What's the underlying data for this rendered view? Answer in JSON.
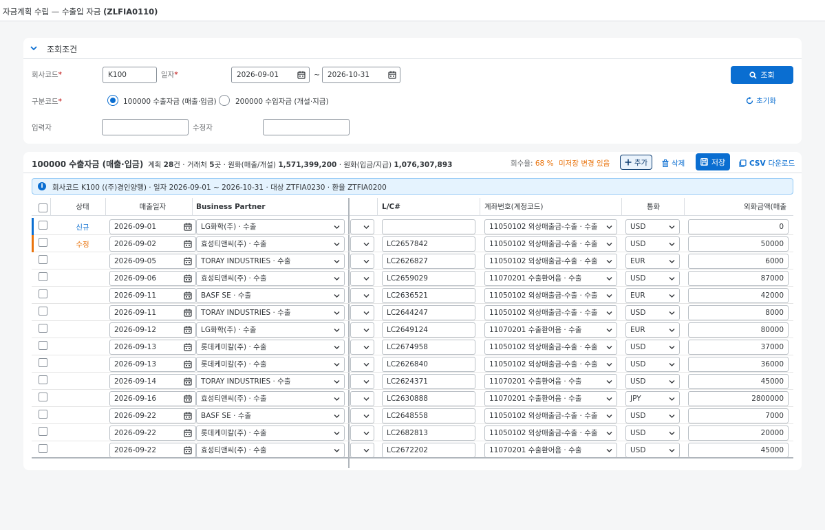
{
  "app": {
    "title_prefix": "자금계획 수립 — 수출입 자금 ",
    "title_code": "(ZLFIA0110)"
  },
  "filter": {
    "section_title": "조회조건",
    "company_label": "회사코드",
    "company_value": "K100",
    "date_label": "일자",
    "date_from": "2026-09-01",
    "date_sep": "~",
    "date_to": "2026-10-31",
    "type_label": "구분코드",
    "options": [
      {
        "label": "100000 수출자금 (매출·입금)",
        "selected": true
      },
      {
        "label": "200000 수입자금 (개설·지급)",
        "selected": false
      }
    ],
    "creator_label": "입력자",
    "creator_value": "",
    "modifier_label": "수정자",
    "modifier_value": "",
    "search_button": "조회",
    "reset_button": "초기화",
    "required_mark": "*"
  },
  "toolbar": {
    "title": "100000 수출자금 (매출·입금)",
    "plan_label": "계획",
    "plan_count": "28",
    "plan_unit": "건 · 거래처",
    "partner_count": "5",
    "partner_unit": "곳 · 원화(매출/개설)",
    "krw_sales": "1,571,399,200",
    "krw_recv_label": "· 원화(입금/지급)",
    "krw_recv": "1,076,307,893",
    "rate_label": "회수율:",
    "rate_value": "68 %",
    "unsaved": "미저장 변경 있음",
    "add_button": "추가",
    "delete_button": "삭제",
    "save_button": "저장",
    "csv_prefix": "CSV",
    "csv_suffix": "다운로드"
  },
  "info_text": "회사코드 K100 ((주)경인양행) · 일자 2026-09-01 ~ 2026-10-31 · 대상 ZTFIA0230 · 환율 ZTFIA0200",
  "columns": {
    "status": "상태",
    "sales_date": "매출일자",
    "partner": "Business Partner",
    "lc": "L/C#",
    "account": "계좌번호(계정코드)",
    "currency": "통화",
    "amount": "외화금액(매출"
  },
  "colors": {
    "accent": "#0a6ed1",
    "new_status": "#0a6ed1",
    "modified_status": "#e9730c"
  },
  "rows": [
    {
      "status": "신규",
      "date": "2026-09-01",
      "partner": "LG화학(주) · 수출",
      "lc": "",
      "account": "11050102 외상매출금-수출 · 수출",
      "currency": "USD",
      "amount": "0"
    },
    {
      "status": "수정",
      "date": "2026-09-02",
      "partner": "효성티앤씨(주) · 수출",
      "lc": "LC2657842",
      "account": "11050102 외상매출금-수출 · 수출",
      "currency": "USD",
      "amount": "50000"
    },
    {
      "status": "",
      "date": "2026-09-05",
      "partner": "TORAY INDUSTRIES · 수출",
      "lc": "LC2626827",
      "account": "11050102 외상매출금-수출 · 수출",
      "currency": "EUR",
      "amount": "6000"
    },
    {
      "status": "",
      "date": "2026-09-06",
      "partner": "효성티앤씨(주) · 수출",
      "lc": "LC2659029",
      "account": "11070201 수출환어음 · 수출",
      "currency": "USD",
      "amount": "87000"
    },
    {
      "status": "",
      "date": "2026-09-11",
      "partner": "BASF SE · 수출",
      "lc": "LC2636521",
      "account": "11050102 외상매출금-수출 · 수출",
      "currency": "EUR",
      "amount": "42000"
    },
    {
      "status": "",
      "date": "2026-09-11",
      "partner": "TORAY INDUSTRIES · 수출",
      "lc": "LC2644247",
      "account": "11050102 외상매출금-수출 · 수출",
      "currency": "USD",
      "amount": "8000"
    },
    {
      "status": "",
      "date": "2026-09-12",
      "partner": "LG화학(주) · 수출",
      "lc": "LC2649124",
      "account": "11070201 수출환어음 · 수출",
      "currency": "EUR",
      "amount": "80000"
    },
    {
      "status": "",
      "date": "2026-09-13",
      "partner": "롯데케미칼(주) · 수출",
      "lc": "LC2674958",
      "account": "11050102 외상매출금-수출 · 수출",
      "currency": "USD",
      "amount": "37000"
    },
    {
      "status": "",
      "date": "2026-09-13",
      "partner": "롯데케미칼(주) · 수출",
      "lc": "LC2626840",
      "account": "11050102 외상매출금-수출 · 수출",
      "currency": "USD",
      "amount": "36000"
    },
    {
      "status": "",
      "date": "2026-09-14",
      "partner": "TORAY INDUSTRIES · 수출",
      "lc": "LC2624371",
      "account": "11070201 수출환어음 · 수출",
      "currency": "USD",
      "amount": "45000"
    },
    {
      "status": "",
      "date": "2026-09-16",
      "partner": "효성티앤씨(주) · 수출",
      "lc": "LC2630888",
      "account": "11070201 수출환어음 · 수출",
      "currency": "JPY",
      "amount": "2800000"
    },
    {
      "status": "",
      "date": "2026-09-22",
      "partner": "BASF SE · 수출",
      "lc": "LC2648558",
      "account": "11050102 외상매출금-수출 · 수출",
      "currency": "USD",
      "amount": "7000"
    },
    {
      "status": "",
      "date": "2026-09-22",
      "partner": "롯데케미칼(주) · 수출",
      "lc": "LC2682813",
      "account": "11050102 외상매출금-수출 · 수출",
      "currency": "USD",
      "amount": "20000"
    },
    {
      "status": "",
      "date": "2026-09-22",
      "partner": "효성티앤씨(주) · 수출",
      "lc": "LC2672202",
      "account": "11070201 수출환어음 · 수출",
      "currency": "USD",
      "amount": "45000"
    }
  ]
}
